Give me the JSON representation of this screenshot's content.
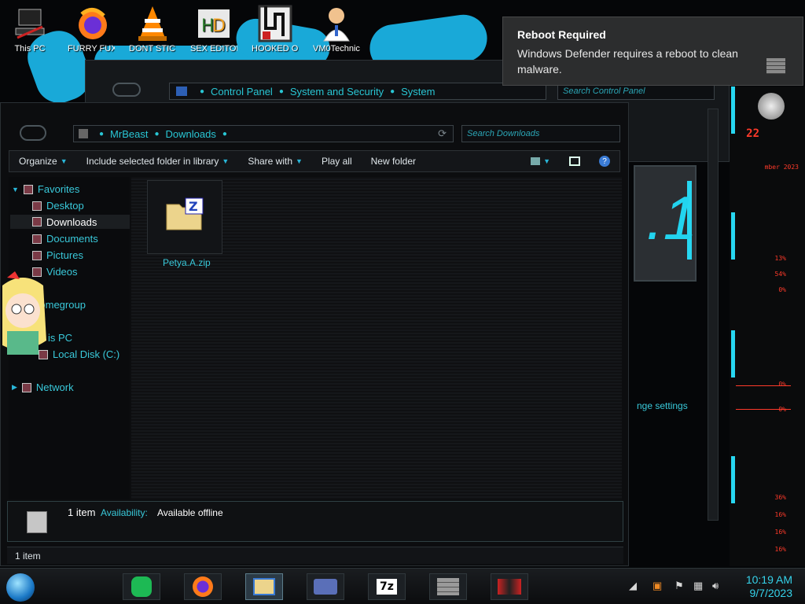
{
  "desktop": {
    "icons": [
      {
        "label": "This PC",
        "icon": "computer-icon"
      },
      {
        "label": "FURRY FUX",
        "icon": "firefox-icon"
      },
      {
        "label": "DONT STICK",
        "icon": "vlc-cone-icon"
      },
      {
        "label": "SEX EDITOR",
        "icon": "hex-editor-icon"
      },
      {
        "label": "HOOKED ON",
        "icon": "maze-icon"
      },
      {
        "label": "VM0Technic...",
        "icon": "doctor-icon"
      }
    ]
  },
  "background_window": {
    "breadcrumb": [
      "Control Panel",
      "System and Security",
      "System"
    ],
    "search_placeholder": "Search Control Panel",
    "change_settings_link": "nge settings"
  },
  "explorer": {
    "breadcrumb": [
      "MrBeast",
      "Downloads"
    ],
    "search_placeholder": "Search Downloads",
    "toolbar": {
      "organize": "Organize",
      "include": "Include selected folder in library",
      "share": "Share with",
      "play": "Play all",
      "new_folder": "New folder"
    },
    "nav": {
      "favorites": "Favorites",
      "desktop": "Desktop",
      "downloads": "Downloads",
      "documents": "Documents",
      "pictures": "Pictures",
      "videos": "Videos",
      "homegroup": "Homegroup",
      "this_pc": "is PC",
      "local_disk": "Local Disk (C:)",
      "network": "Network"
    },
    "file": {
      "name": "Petya.A.zip",
      "icon": "zip-folder-icon"
    },
    "details": {
      "count": "1 item",
      "availability_label": "Availability:",
      "availability_value": "Available offline"
    },
    "status": "1 item"
  },
  "gadget": {
    "readouts": [
      "22",
      "mber 2023",
      "13%",
      "54%",
      "0%",
      "0%",
      "0%",
      "36%",
      "16%",
      "16%",
      "16%"
    ]
  },
  "toast": {
    "title": "Reboot Required",
    "message": "Windows Defender requires a reboot to clean malware."
  },
  "taskbar": {
    "time": "10:19 AM",
    "date": "9/7/2023",
    "apps": [
      "start-orb-icon",
      "sticky-notes-icon",
      "firefox-icon",
      "file-explorer-icon",
      "card-icon",
      "7zip-icon",
      "wall-icon",
      "mirror-icon"
    ]
  },
  "colors": {
    "accent": "#29c6d4",
    "toast_bg": "#2c2d2e",
    "red_readout": "#ff3a2a",
    "clock": "#35d2ea"
  }
}
